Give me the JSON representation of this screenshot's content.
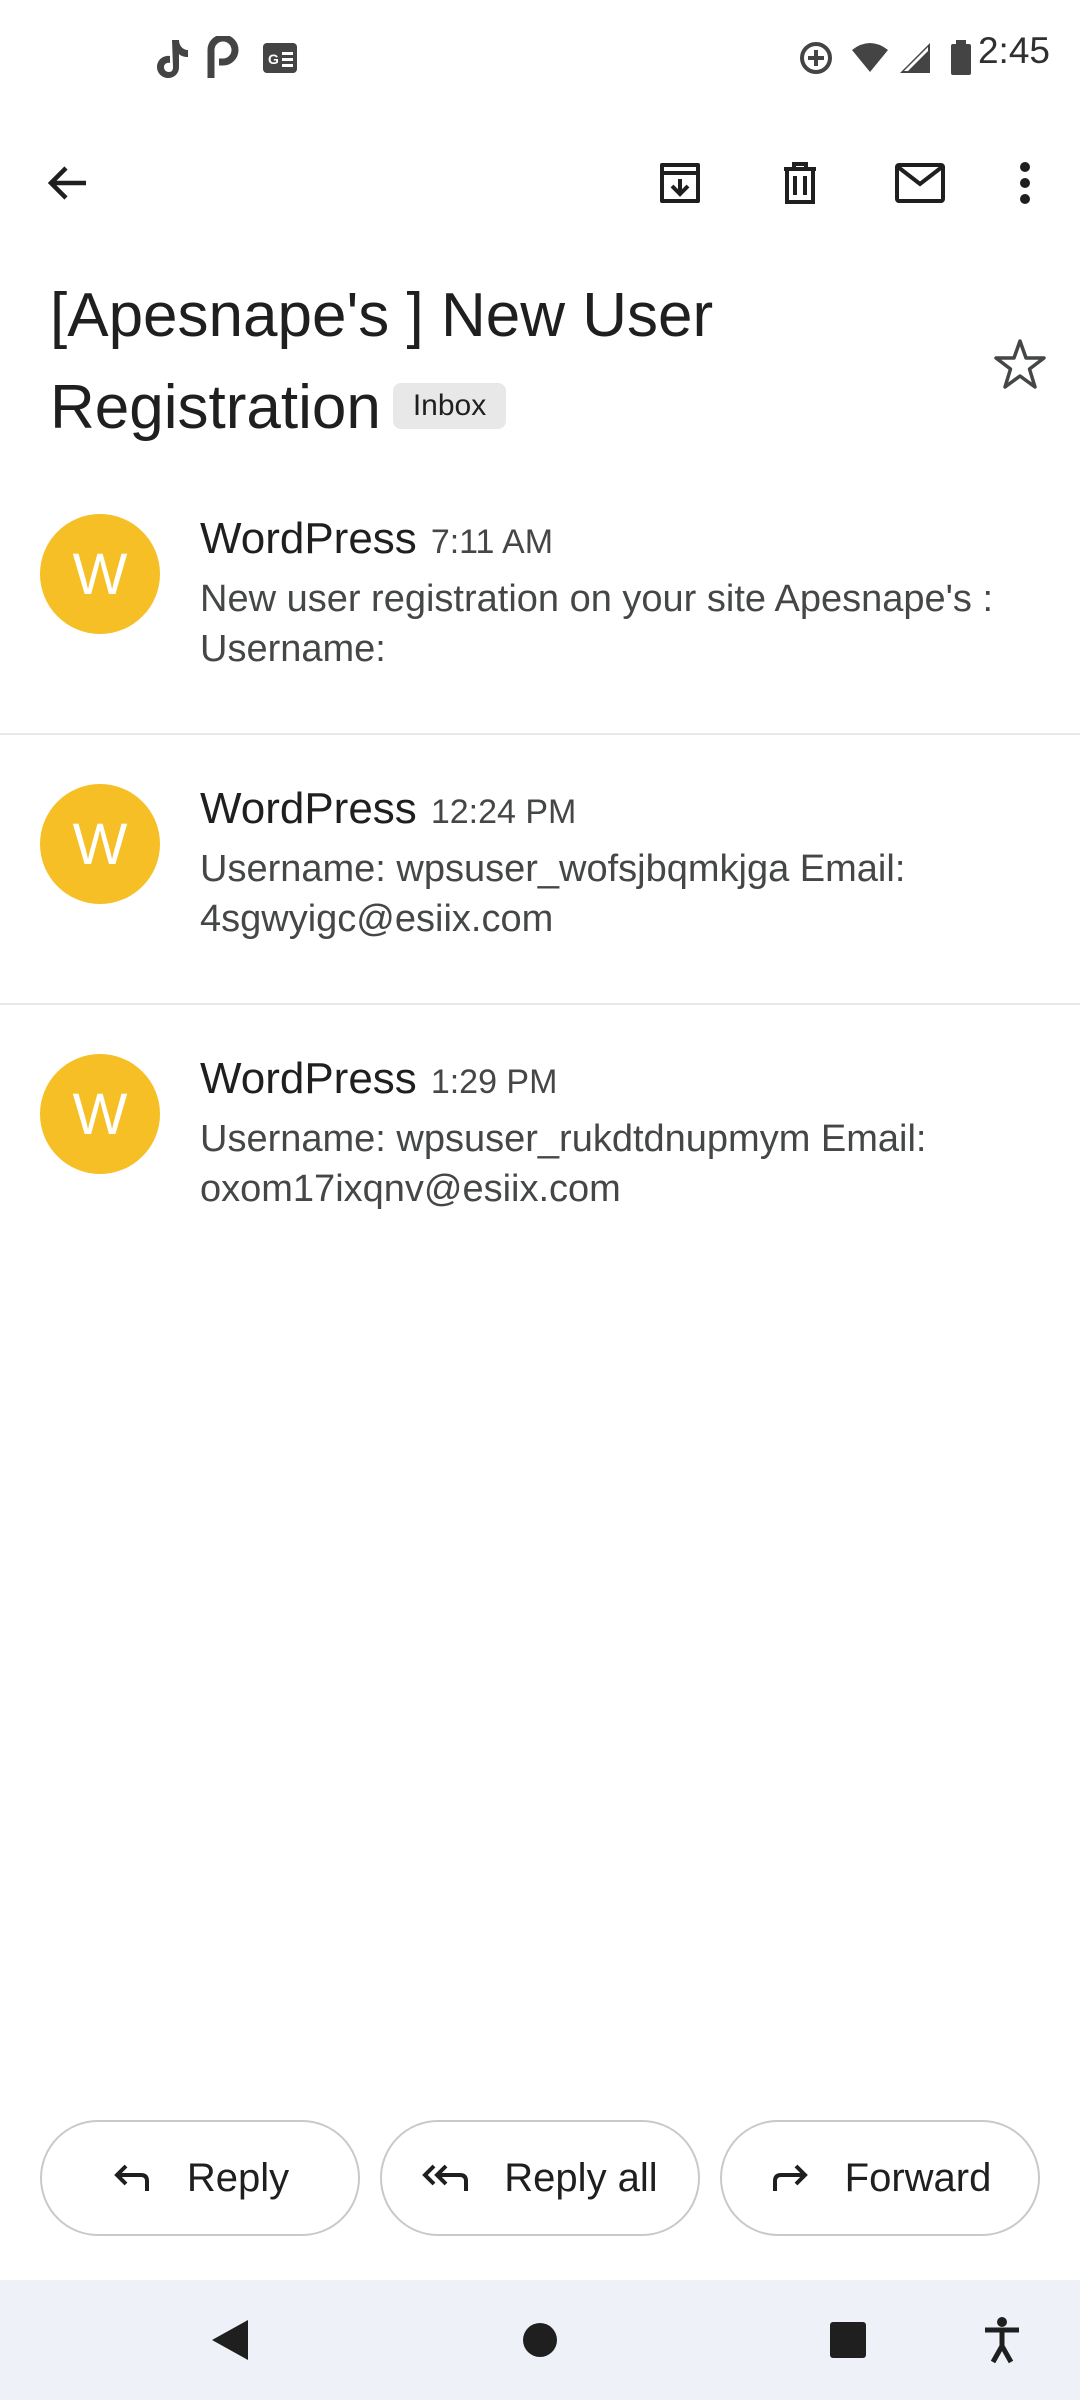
{
  "status_bar": {
    "time": "2:45",
    "icons": [
      "tiktok-icon",
      "parking-p-icon",
      "news-icon",
      "data-saver-icon",
      "wifi-icon",
      "signal-icon",
      "battery-icon"
    ]
  },
  "toolbar": {
    "icons": [
      "back-arrow-icon",
      "archive-icon",
      "delete-icon",
      "mark-unread-icon",
      "more-vert-icon"
    ]
  },
  "email": {
    "subject": "[Apesnape's ] New User Registration",
    "label": "Inbox"
  },
  "messages": [
    {
      "avatar_letter": "W",
      "sender": "WordPress",
      "time": "7:11 AM",
      "snippet": "New user registration on your site Apesnape's : Username:"
    },
    {
      "avatar_letter": "W",
      "sender": "WordPress",
      "time": "12:24 PM",
      "snippet": "Username: wpsuser_wofsjbqmkjga Email: 4sgwyigc@esiix.com"
    },
    {
      "avatar_letter": "W",
      "sender": "WordPress",
      "time": "1:29 PM",
      "snippet": "Username: wpsuser_rukdtdnupmym Email: oxom17ixqnv@esiix.com"
    }
  ],
  "actions": {
    "reply": "Reply",
    "reply_all": "Reply all",
    "forward": "Forward"
  },
  "colors": {
    "avatar": "#f6bf26",
    "nav_bar_bg": "#eef2f8"
  }
}
